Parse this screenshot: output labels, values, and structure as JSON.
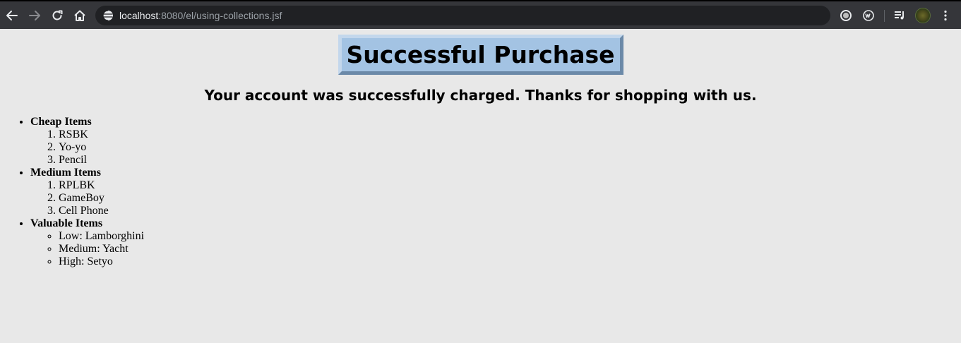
{
  "browser": {
    "url_host": "localhost",
    "url_rest": ":8080/el/using-collections.jsf"
  },
  "page": {
    "title": "Successful Purchase",
    "subtitle": "Your account was successfully charged. Thanks for shopping with us."
  },
  "categories": [
    {
      "label": "Cheap Items",
      "list_type": "ordered",
      "items": [
        "RSBK",
        "Yo-yo",
        "Pencil"
      ]
    },
    {
      "label": "Medium Items",
      "list_type": "ordered",
      "items": [
        "RPLBK",
        "GameBoy",
        "Cell Phone"
      ]
    },
    {
      "label": "Valuable Items",
      "list_type": "unordered",
      "items": [
        "Low: Lamborghini",
        "Medium: Yacht",
        "High: Setyo"
      ]
    }
  ]
}
